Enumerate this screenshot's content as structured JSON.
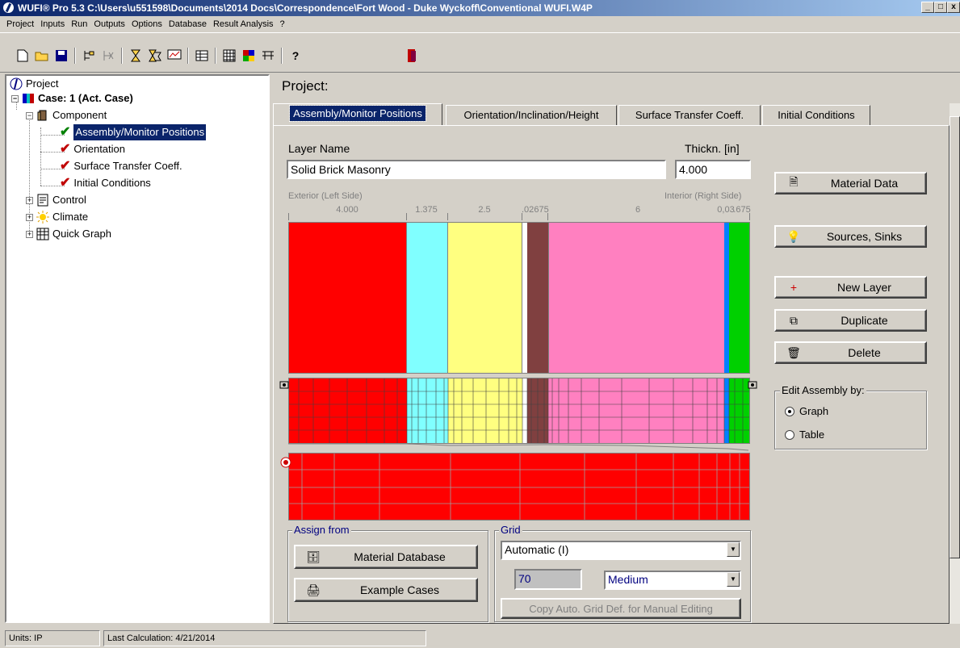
{
  "window": {
    "title": "WUFI® Pro 5.3    C:\\Users\\u551598\\Documents\\2014 Docs\\Correspondence\\Fort Wood - Duke Wyckoff\\Conventional WUFI.W4P",
    "minimize": "_",
    "maximize": "□",
    "close": "x"
  },
  "menu": [
    "Project",
    "Inputs",
    "Run",
    "Outputs",
    "Options",
    "Database",
    "Result Analysis",
    "?"
  ],
  "toolbar": {
    "help_label": "?"
  },
  "tree": {
    "root": "Project",
    "case": "Case: 1  (Act. Case)",
    "component": "Component",
    "items": [
      "Assembly/Monitor Positions",
      "Orientation",
      "Surface Transfer Coeff.",
      "Initial Conditions"
    ],
    "control": "Control",
    "climate": "Climate",
    "quick_graph": "Quick Graph"
  },
  "panel_title": "Project:",
  "tabs": [
    "Assembly/Monitor Positions",
    "Orientation/Inclination/Height",
    "Surface Transfer Coeff.",
    "Initial Conditions"
  ],
  "layer": {
    "name_label": "Layer Name",
    "name_value": "Solid Brick Masonry",
    "thickness_label": "Thickn. [in]",
    "thickness_value": "4.000",
    "exterior_label": "Exterior (Left Side)",
    "interior_label": "Interior (Right Side)"
  },
  "ruler": [
    "4.000",
    "1.375",
    "2.5",
    ".02",
    ".675",
    "6",
    "0,03",
    ".675"
  ],
  "layers": [
    {
      "color": "#ff0000"
    },
    {
      "color": "#80ffff"
    },
    {
      "color": "#ffff80"
    },
    {
      "color": "#ffffff"
    },
    {
      "color": "#804040"
    },
    {
      "color": "#ff80c0"
    },
    {
      "color": "#0080ff"
    },
    {
      "color": "#00d000"
    }
  ],
  "actions": {
    "material_data": "Material Data",
    "sources_sinks": "Sources, Sinks",
    "new_layer": "New Layer",
    "duplicate": "Duplicate",
    "delete": "Delete"
  },
  "edit_by": {
    "title": "Edit Assembly by:",
    "options": [
      "Graph",
      "Table"
    ],
    "selected": "Graph"
  },
  "assign_from": {
    "title": "Assign from",
    "material_database": "Material Database",
    "example_cases": "Example Cases"
  },
  "grid": {
    "title": "Grid",
    "mode": "Automatic (I)",
    "count": "70",
    "density": "Medium",
    "copy_button": "Copy Auto. Grid Def. for Manual Editing"
  },
  "status": {
    "units": "Units: IP",
    "last_calc": "Last Calculation: 4/21/2014"
  }
}
